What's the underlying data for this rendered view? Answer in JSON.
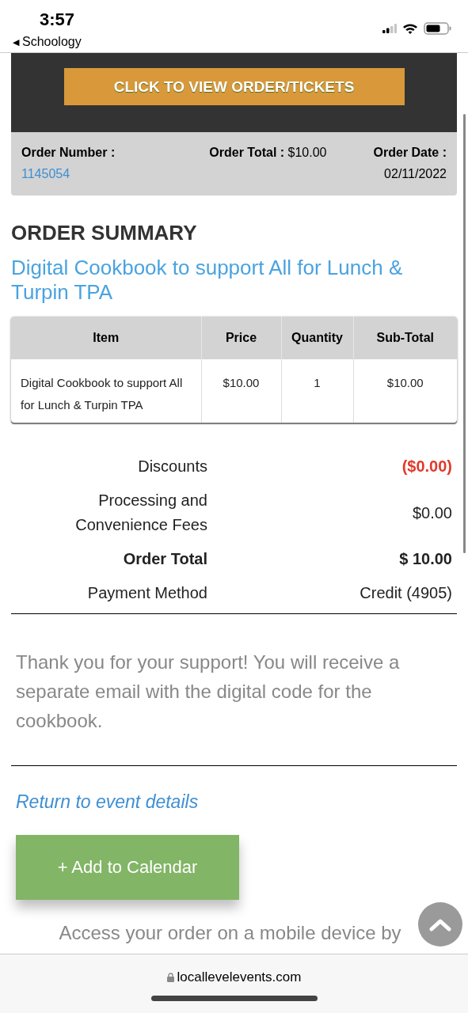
{
  "status_bar": {
    "time": "3:57",
    "back_glyph": "◀",
    "back_app": "Schoology"
  },
  "order_button": "CLICK TO VIEW ORDER/TICKETS",
  "order_info": {
    "number_label": "Order Number :",
    "number": "1145054",
    "total_label": "Order Total :",
    "total": "$10.00",
    "date_label": "Order Date :",
    "date": "02/11/2022"
  },
  "summary_heading": "ORDER SUMMARY",
  "event_title": "Digital Cookbook to support All for Lunch & Turpin TPA",
  "table": {
    "columns": [
      "Item",
      "Price",
      "Quantity",
      "Sub-Total"
    ],
    "rows": [
      [
        "Digital Cookbook to support All for Lunch & Turpin TPA",
        "$10.00",
        "1",
        "$10.00"
      ]
    ]
  },
  "totals": [
    {
      "kind": "discount",
      "label": "Discounts",
      "value": "($0.00)"
    },
    {
      "kind": "plain",
      "label": "Processing and Convenience Fees",
      "value": "$0.00"
    },
    {
      "kind": "total",
      "label": "Order Total",
      "value": "$ 10.00"
    },
    {
      "kind": "plain",
      "label": "Payment Method",
      "value": "Credit (4905)"
    }
  ],
  "thank_you": "Thank you for your support! You will receive a separate email with the digital code for the cookbook.",
  "return_link": "Return to event details",
  "calendar_button": "+ Add to Calendar",
  "app_note": "Access your order on a mobile device by",
  "browser": {
    "url": "locallevelevents.com"
  }
}
